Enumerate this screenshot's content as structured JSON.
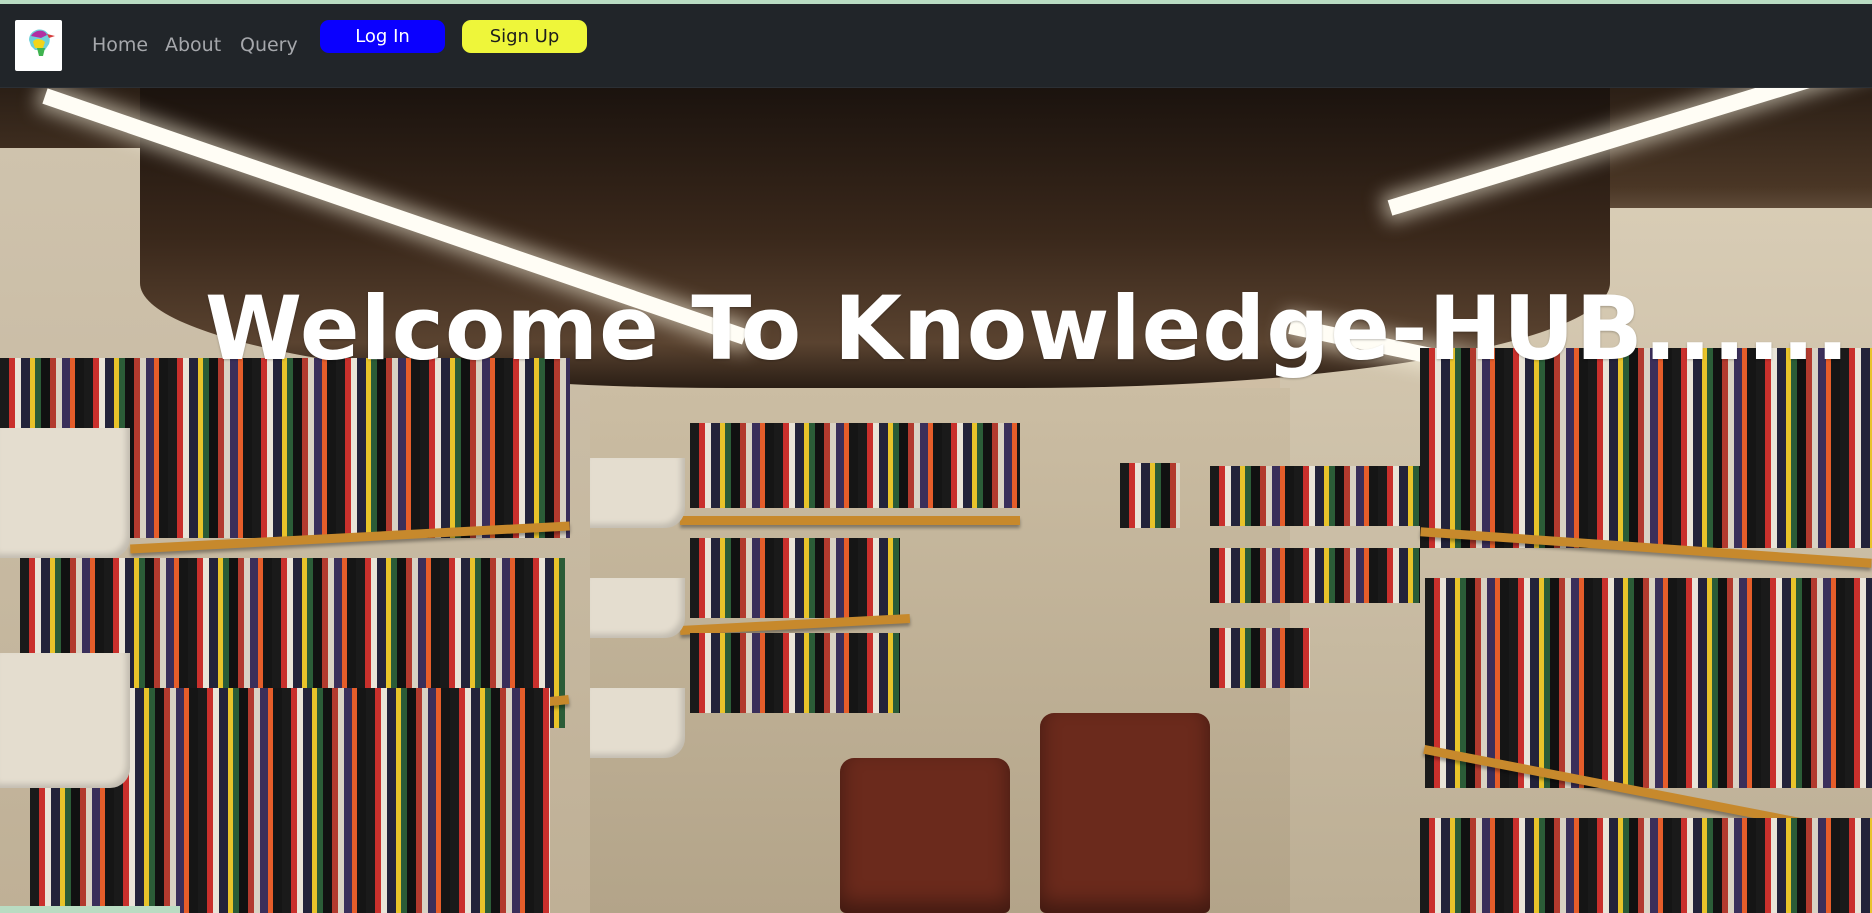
{
  "nav": {
    "logo": "knowledge-hub-logo-icon",
    "links": [
      "Home",
      "About",
      "Query"
    ],
    "login_label": "Log In",
    "signup_label": "Sign Up"
  },
  "hero": {
    "title": "Welcome To Knowledge-HUB......",
    "background": "library-bookshelves-photo"
  },
  "colors": {
    "navbar_bg": "#212529",
    "nav_link": "#a5a7ab",
    "login_bg": "#0a00ff",
    "signup_bg": "#eef63a",
    "accent_strip": "#b9dcc2"
  }
}
